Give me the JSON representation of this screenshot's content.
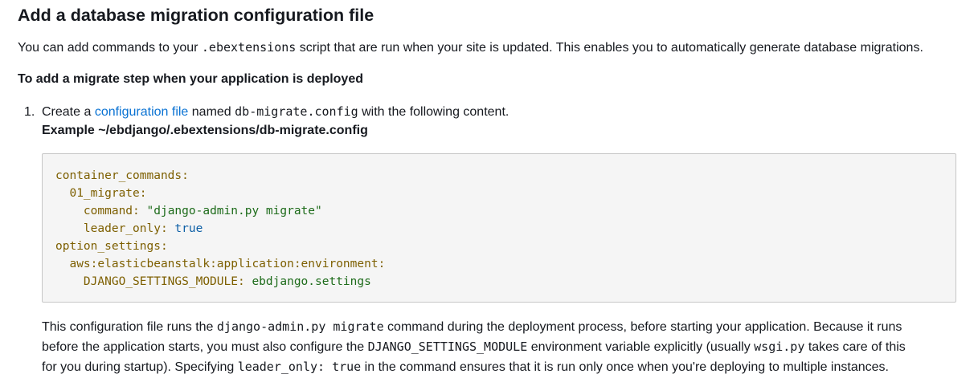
{
  "heading": "Add a database migration configuration file",
  "intro": {
    "before": "You can add commands to your ",
    "code": ".ebextensions",
    "after": " script that are run when your site is updated. This enables you to automatically generate database migrations."
  },
  "procedure_title": "To add a migrate step when your application is deployed",
  "step1": {
    "number": "1.",
    "text_before": "Create a ",
    "link": "configuration file",
    "text_middle": " named ",
    "filename": "db-migrate.config",
    "text_after": " with the following content."
  },
  "example_title": "Example ~/ebdjango/.ebextensions/db-migrate.config",
  "code_lines": {
    "l1": "container_commands:",
    "l2_key": "01_migrate:",
    "l3_key": "command: ",
    "l3_val": "\"django-admin.py migrate\"",
    "l4_key": "leader_only: ",
    "l4_val": "true",
    "l5": "option_settings:",
    "l6_key": "aws:elasticbeanstalk:application:environment:",
    "l7_key": "DJANGO_SETTINGS_MODULE: ",
    "l7_val": "ebdjango.settings"
  },
  "explanation": {
    "line1_a": "This configuration file runs the ",
    "line1_code": "django-admin.py migrate",
    "line1_b": " command during the deployment process, before starting your application. Because it runs",
    "line2_a": "before the application starts, you must also configure the ",
    "line2_code1": "DJANGO_SETTINGS_MODULE",
    "line2_b": " environment variable explicitly (usually ",
    "line2_code2": "wsgi.py",
    "line2_c": " takes care of this",
    "line3_a": "for you during startup). Specifying ",
    "line3_code": "leader_only: true",
    "line3_b": " in the command ensures that it is run only once when you're deploying to multiple instances."
  },
  "colors": {
    "link": "#0972d3",
    "code_key": "#7d5f00",
    "code_string": "#1d6b1a",
    "code_bool": "#0d5fa6",
    "codebox_bg": "#f5f5f5"
  }
}
